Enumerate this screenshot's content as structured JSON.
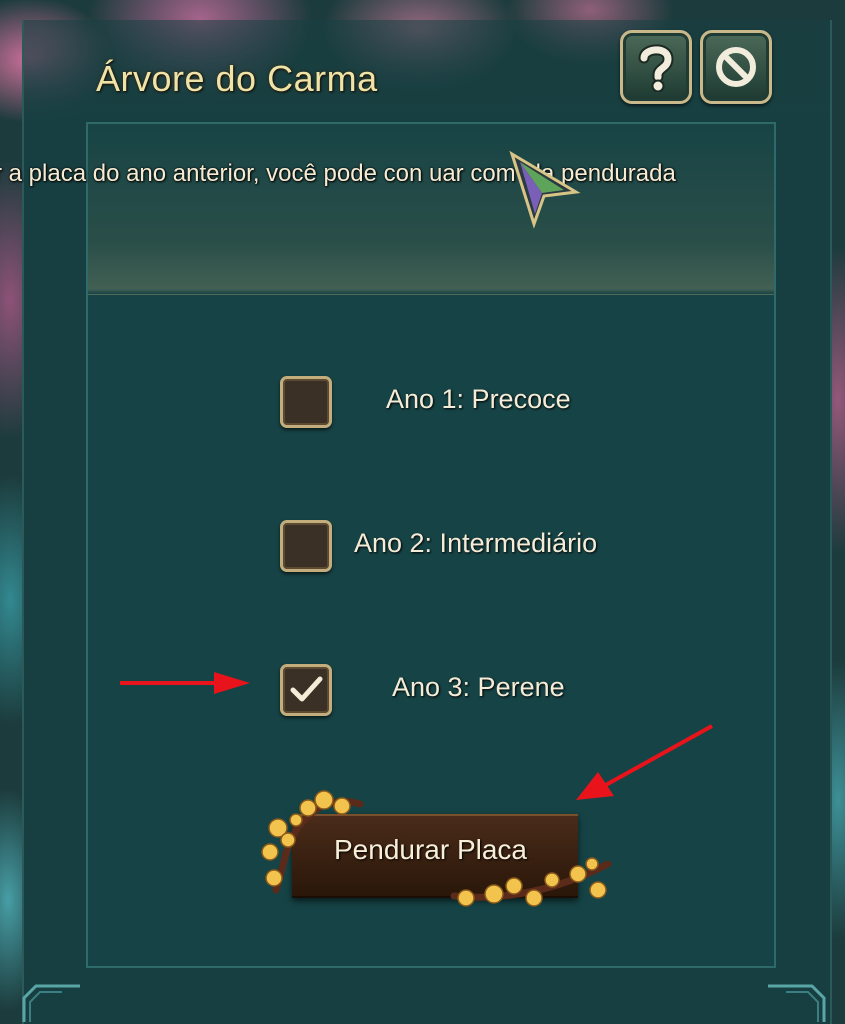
{
  "window": {
    "title": "Árvore do Carma"
  },
  "header": {
    "help_icon": "question-mark-icon",
    "close_icon": "prohibited-circle-icon"
  },
  "notice": {
    "text": "r a placa do ano anterior, você pode con    uar com ela pendurada"
  },
  "options": [
    {
      "label": "Ano 1: Precoce",
      "checked": false
    },
    {
      "label": "Ano 2: Intermediário",
      "checked": false
    },
    {
      "label": "Ano 3: Perene",
      "checked": true
    }
  ],
  "action": {
    "label": "Pendurar Placa"
  },
  "annotations": {
    "arrow_color": "#e8131b"
  },
  "colors": {
    "title_gold": "#f0e3a8",
    "panel_teal": "#164345",
    "button_brown": "#3a2212"
  }
}
